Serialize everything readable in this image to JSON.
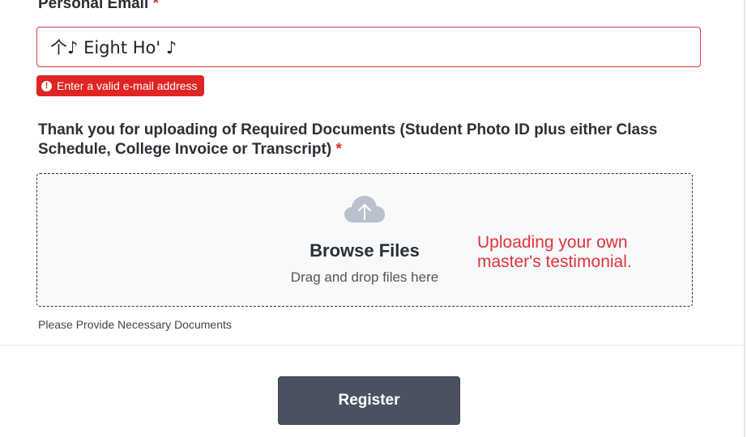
{
  "email": {
    "label": "Personal Email",
    "required_mark": "*",
    "value": "个♪ Eight Ho' ♪",
    "error": "Enter a valid e-mail address",
    "error_icon": "!"
  },
  "documents": {
    "label": "Thank you for uploading of Required Documents (Student Photo ID plus either Class Schedule, College Invoice or Transcript)",
    "required_mark": "*",
    "upload_icon": "cloud-upload-icon",
    "browse_title": "Browse Files",
    "browse_subtitle": "Drag and drop files here",
    "annotation_line1": "Uploading your own",
    "annotation_line2": "master's testimonial.",
    "hint": "Please Provide Necessary Documents"
  },
  "register": {
    "label": "Register"
  },
  "colors": {
    "error": "#e02424",
    "button": "#4a5260",
    "annotation": "#e0343a"
  }
}
